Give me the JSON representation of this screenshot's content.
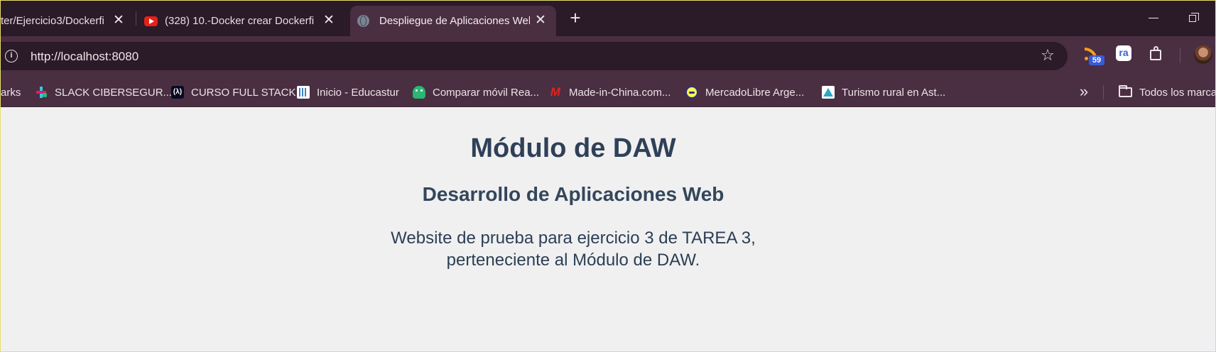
{
  "tabs": [
    {
      "title": "ter/Ejercicio3/Dockerfi",
      "icon": "github-icon"
    },
    {
      "title": "(328) 10.-Docker crear Dockerfi",
      "icon": "youtube-icon"
    },
    {
      "title": "Despliegue de Aplicaciones Web",
      "icon": "globe-icon",
      "active": true
    }
  ],
  "toolbar": {
    "url": "http://localhost:8080",
    "rss_badge": "59",
    "ra_label": "ra"
  },
  "bookmarks": {
    "items": [
      {
        "label": "arks",
        "icon": "bookmarks-icon"
      },
      {
        "label": "SLACK CIBERSEGUR...",
        "icon": "slack-icon"
      },
      {
        "label": "CURSO FULL STACK",
        "icon": "freecodecamp-icon"
      },
      {
        "label": "Inicio - Educastur",
        "icon": "educastur-icon"
      },
      {
        "label": "Comparar móvil Rea...",
        "icon": "android-icon"
      },
      {
        "label": "Made-in-China.com...",
        "icon": "made-in-china-icon"
      },
      {
        "label": "MercadoLibre Arge...",
        "icon": "mercadolibre-icon"
      },
      {
        "label": "Turismo rural en Ast...",
        "icon": "turismo-rural-icon"
      }
    ],
    "fcc_glyph": "(λ)",
    "mic_glyph": "M",
    "all_bookmarks_label": "Todos los marca"
  },
  "page": {
    "heading": "Módulo de DAW",
    "subheading": "Desarrollo de Aplicaciones Web",
    "paragraph": "Website de prueba para ejercicio 3 de TAREA 3, perteneciente al Módulo de DAW."
  },
  "colors": {
    "tabstrip": "#2b1a27",
    "toolbar": "#4a2e42",
    "page_background": "#f0f0f0",
    "heading_text": "#2f4058"
  }
}
